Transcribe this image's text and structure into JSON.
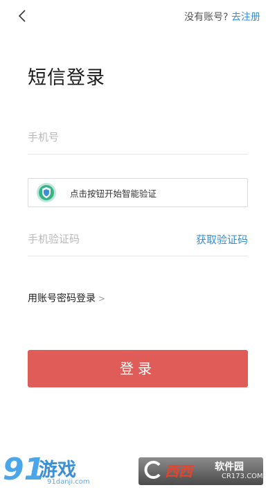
{
  "header": {
    "back_icon": "chevron-left-icon",
    "no_account_text": "没有账号?",
    "register_link": "去注册"
  },
  "page_title": "短信登录",
  "phone_field": {
    "placeholder": "手机号",
    "value": ""
  },
  "captcha": {
    "icon": "shield-icon",
    "text": "点击按钮开始智能验证"
  },
  "code_field": {
    "placeholder": "手机验证码",
    "value": "",
    "get_code_label": "获取验证码"
  },
  "password_login": {
    "label": "用账号密码登录",
    "chevron": ">"
  },
  "login_button": {
    "label": "登录"
  },
  "watermarks": {
    "left": {
      "number": "91",
      "name": "游戏",
      "url": "91danji.com"
    },
    "right": {
      "brand": "西西",
      "soft": "软件园",
      "url": "CR173.COM"
    }
  },
  "colors": {
    "accent_blue": "#2f8fd8",
    "login_red": "#e05c58"
  }
}
